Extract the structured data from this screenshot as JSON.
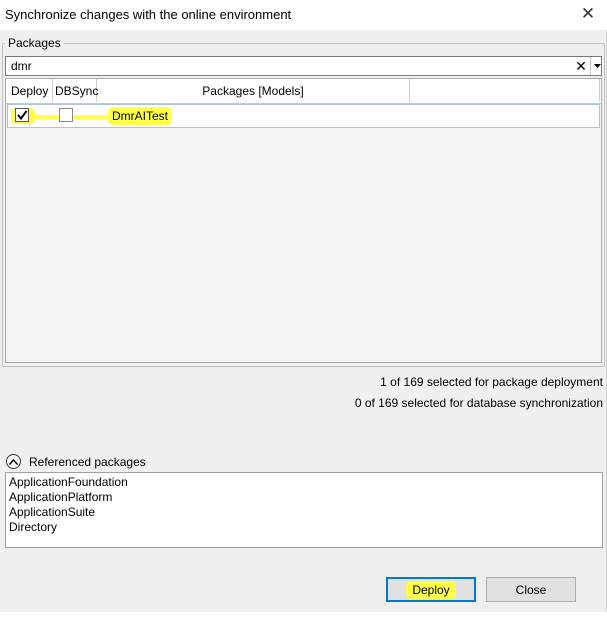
{
  "window": {
    "title": "Synchronize changes with the online environment",
    "close_glyph": "✕"
  },
  "packages": {
    "group_label": "Packages",
    "search": {
      "value": "dmr",
      "clear_glyph": "✕"
    },
    "columns": [
      "Deploy",
      "DBSync",
      "Packages [Models]"
    ],
    "rows": [
      {
        "deploy": true,
        "dbsync": false,
        "name": "DmrAITest"
      }
    ]
  },
  "status": {
    "deploy_count_text": "1 of 169 selected for package deployment",
    "dbsync_count_text": "0 of 169 selected for database synchronization"
  },
  "referenced": {
    "label": "Referenced packages",
    "items": [
      "ApplicationFoundation",
      "ApplicationPlatform",
      "ApplicationSuite",
      "Directory"
    ]
  },
  "buttons": {
    "deploy": "Deploy",
    "close": "Close"
  },
  "colors": {
    "highlight": "#ffff4a",
    "primary_border": "#0078d7"
  }
}
